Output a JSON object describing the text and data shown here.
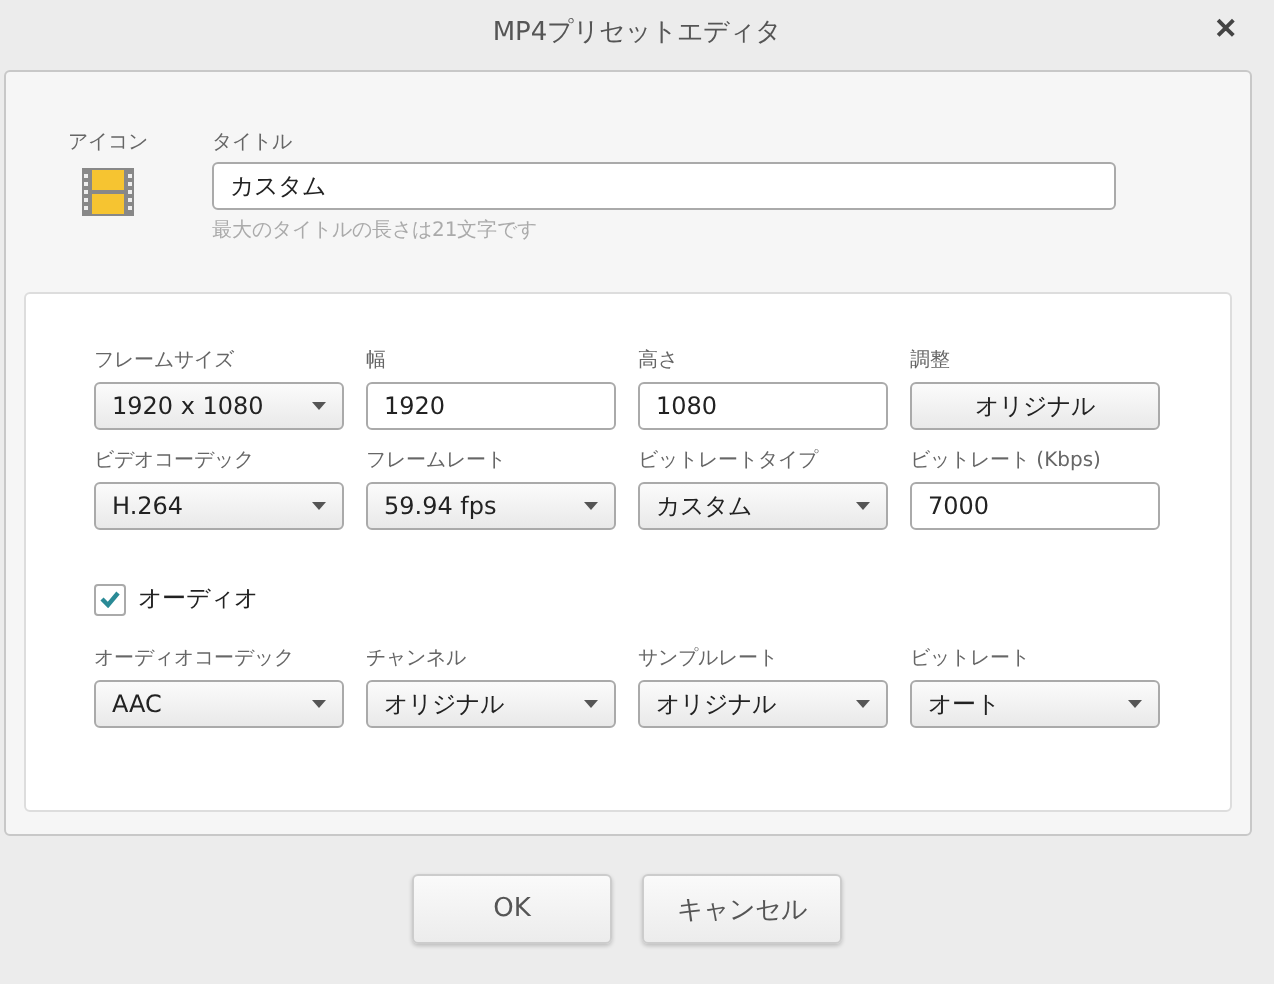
{
  "window": {
    "title": "MP4プリセットエディタ",
    "close": "✕"
  },
  "header": {
    "icon_label": "アイコン",
    "title_label": "タイトル",
    "title_value": "カスタム",
    "hint": "最大のタイトルの長さは21文字です"
  },
  "video_fields": [
    {
      "label": "フレームサイズ",
      "kind": "select",
      "value": "1920 x 1080"
    },
    {
      "label": "幅",
      "kind": "input",
      "value": "1920"
    },
    {
      "label": "高さ",
      "kind": "input",
      "value": "1080"
    },
    {
      "label": "調整",
      "kind": "button",
      "button_text": "オリジナル"
    },
    {
      "label": "ビデオコーデック",
      "kind": "select",
      "value": "H.264"
    },
    {
      "label": "フレームレート",
      "kind": "select",
      "value": "59.94 fps"
    },
    {
      "label": "ビットレートタイプ",
      "kind": "select",
      "value": "カスタム"
    },
    {
      "label": "ビットレート (Kbps)",
      "kind": "input",
      "value": "7000"
    }
  ],
  "audio": {
    "label": "オーディオ",
    "checked": true
  },
  "audio_fields": [
    {
      "label": "オーディオコーデック",
      "kind": "select",
      "value": "AAC"
    },
    {
      "label": "チャンネル",
      "kind": "select",
      "value": "オリジナル"
    },
    {
      "label": "サンプルレート",
      "kind": "select",
      "value": "オリジナル"
    },
    {
      "label": "ビットレート",
      "kind": "select",
      "value": "オート"
    }
  ],
  "buttons": [
    "OK",
    "キャンセル"
  ]
}
